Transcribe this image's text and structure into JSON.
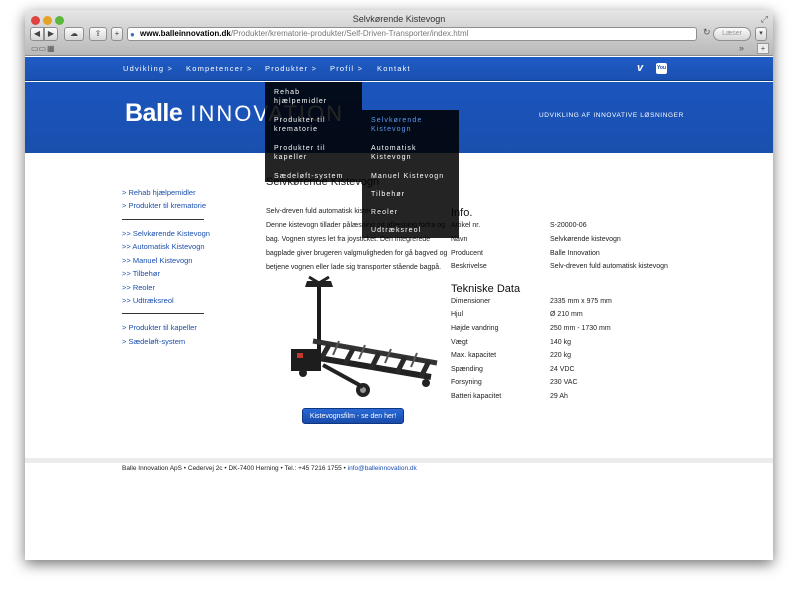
{
  "window": {
    "title": "Selvkørende Kistevogn"
  },
  "browser": {
    "url_domain": "www.balleinnovation.dk",
    "url_path": "/Produkter/krematorie-produkter/Self-Driven-Transporter/index.html",
    "reader_label": "Læser",
    "icons": [
      "back-icon",
      "forward-icon",
      "cloud-icon",
      "share-icon",
      "plus-icon",
      "globe-icon",
      "reload-icon",
      "book-icon",
      "grid-icon"
    ]
  },
  "nav": {
    "items": [
      "Udvikling >",
      "Kompetencer >",
      "Produkter >",
      "Profil >",
      "Kontakt"
    ],
    "vimeo_glyph": "v",
    "youtube_glyph": "You Tube"
  },
  "banner": {
    "logo_bold": "Balle",
    "logo_light": " INNOVATION",
    "tagline": "UDVIKLING AF INNOVATIVE LØSNINGER"
  },
  "dropdown1": [
    "Rehab hjælpemidler",
    "Produkter til krematorie",
    "Produkter til kapeller",
    "Sædeløft-system"
  ],
  "dropdown2": [
    "Selvkørende Kistevogn",
    "Automatisk Kistevogn",
    "Manuel Kistevogn",
    "Tilbehør",
    "Reoler",
    "Udtræksreol"
  ],
  "sidebar": {
    "group1": [
      "> Rehab hjælpemidler",
      "> Produkter til krematorie"
    ],
    "group2": [
      ">> Selvkørende Kistevogn",
      ">> Automatisk Kistevogn",
      ">> Manuel Kistevogn",
      ">> Tilbehør",
      ">> Reoler",
      ">> Udtræksreol"
    ],
    "group3": [
      "> Produkter til kapeller",
      "> Sædeløft-system"
    ]
  },
  "main": {
    "title": "Selvkørende Kistevogn",
    "lines": [
      "Selv-dreven fuld automatisk kistevogn.",
      "Denne kistevogn tillader pålæsning og aflæsning forfra og",
      "bag. Vognen styres let fra joysticket. Den integrerede",
      "bagplade giver brugeren valgmuligheden for gå bagved og",
      "betjene vognen eller lade sig transporter stående bagpå."
    ],
    "film_button": "Kistevognsfilm - se den her!"
  },
  "info": {
    "heading": "Info.",
    "rows": [
      {
        "k": "Artikel nr.",
        "v": "S-20000-06"
      },
      {
        "k": "Navn",
        "v": "Selvkørende kistevogn"
      },
      {
        "k": "Producent",
        "v": "Balle Innovation"
      },
      {
        "k": "Beskrivelse",
        "v": "Selv-dreven fuld automatisk kistevogn"
      }
    ]
  },
  "tech": {
    "heading": "Tekniske Data",
    "rows": [
      {
        "k": "Dimensioner",
        "v": "2335 mm x 975 mm"
      },
      {
        "k": "Hjul",
        "v": "Ø 210 mm"
      },
      {
        "k": "Højde vandring",
        "v": "250 mm - 1730 mm"
      },
      {
        "k": "Vægt",
        "v": "140 kg"
      },
      {
        "k": "Max. kapacitet",
        "v": "220 kg"
      },
      {
        "k": "Spænding",
        "v": "24 VDC"
      },
      {
        "k": "Forsyning",
        "v": "230 VAC"
      },
      {
        "k": "Batteri kapacitet",
        "v": "29 Ah"
      }
    ]
  },
  "footer": {
    "address": "Balle Innovation ApS • Cedervej 2c • DK-7400 Herning • Tel.: +45 7216 1755 • ",
    "email": "info@balleinnovation.dk"
  }
}
